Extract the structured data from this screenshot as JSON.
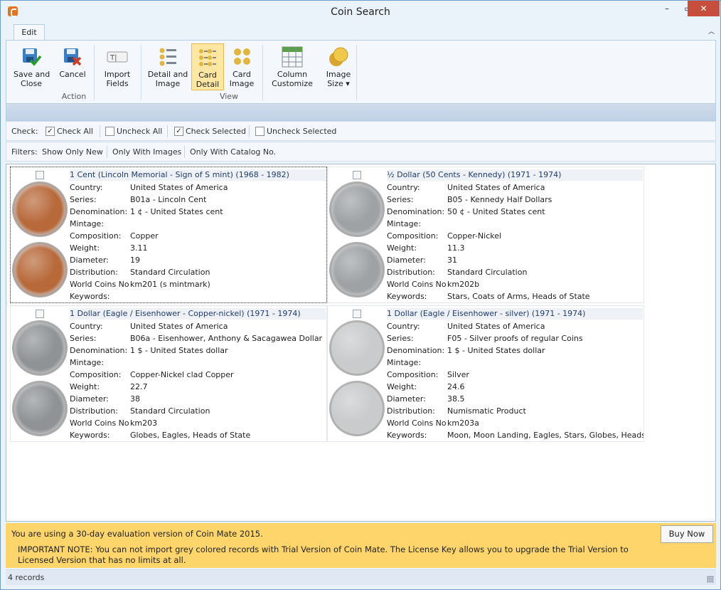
{
  "window": {
    "title": "Coin Search"
  },
  "ribbon": {
    "tab": "Edit",
    "groups": [
      {
        "label": "Action",
        "buttons": [
          {
            "label": "Save and\nClose",
            "icon": "save-check-icon"
          },
          {
            "label": "Cancel",
            "icon": "cancel-icon"
          },
          {
            "label": "Import\nFields",
            "icon": "import-fields-icon"
          }
        ]
      },
      {
        "label": "View",
        "buttons": [
          {
            "label": "Detail and\nImage",
            "icon": "detail-image-icon"
          },
          {
            "label": "Card\nDetail",
            "icon": "card-detail-icon",
            "active": true
          },
          {
            "label": "Card\nImage",
            "icon": "card-image-icon"
          },
          {
            "label": "Column\nCustomize",
            "icon": "column-customize-icon"
          },
          {
            "label": "Image\nSize ▾",
            "icon": "image-size-icon"
          }
        ]
      }
    ]
  },
  "check_bar": {
    "label": "Check:",
    "check_all": "Check All",
    "uncheck_all": "Uncheck All",
    "check_selected": "Check Selected",
    "uncheck_selected": "Uncheck Selected"
  },
  "filter_bar": {
    "label": "Filters:",
    "show_only_new": "Show Only New",
    "only_with_images": "Only With Images",
    "only_with_catalog": "Only With Catalog No."
  },
  "field_labels": {
    "country": "Country:",
    "series": "Series:",
    "denomination": "Denomination:",
    "mintage": "Mintage:",
    "composition": "Composition:",
    "weight": "Weight:",
    "diameter": "Diameter:",
    "distribution": "Distribution:",
    "world_coins_no": "World Coins No",
    "keywords": "Keywords:"
  },
  "cards": [
    {
      "title": "1 Cent (Lincoln Memorial - Sign of S mint)  (1968 - 1982)",
      "country": "United States of America",
      "series": "B01a - Lincoln Cent",
      "denomination": "1 ¢ - United States cent",
      "mintage": "",
      "composition": "Copper",
      "weight": "3.11",
      "diameter": "19",
      "distribution": "Standard Circulation",
      "world_coins_no": "km201 (s mintmark)",
      "keywords": "",
      "coin_color": "#b8693a"
    },
    {
      "title": "½ Dollar (50 Cents - Kennedy)  (1971 - 1974)",
      "country": "United States of America",
      "series": "B05 - Kennedy Half Dollars",
      "denomination": "50 ¢ - United States cent",
      "mintage": "",
      "composition": "Copper-Nickel",
      "weight": "11.3",
      "diameter": "31",
      "distribution": "Standard Circulation",
      "world_coins_no": "km202b",
      "keywords": "Stars, Coats of Arms, Heads of State",
      "coin_color": "#9ea2a5"
    },
    {
      "title": "1 Dollar (Eagle / Eisenhower - Copper-nickel)  (1971 - 1974)",
      "country": "United States of America",
      "series": "B06a - Eisenhower, Anthony & Sacagawea Dollar",
      "denomination": "1 $ - United States dollar",
      "mintage": "",
      "composition": "Copper-Nickel clad Copper",
      "weight": "22.7",
      "diameter": "38",
      "distribution": "Standard Circulation",
      "world_coins_no": "km203",
      "keywords": "Globes, Eagles, Heads of State",
      "coin_color": "#8f9396"
    },
    {
      "title": "1 Dollar (Eagle / Eisenhower - silver)  (1971 - 1974)",
      "country": "United States of America",
      "series": "F05 - Silver proofs of regular Coins",
      "denomination": "1 $ - United States dollar",
      "mintage": "",
      "composition": "Silver",
      "weight": "24.6",
      "diameter": "38.5",
      "distribution": "Numismatic Product",
      "world_coins_no": "km203a",
      "keywords": "Moon, Moon Landing, Eagles, Stars, Globes, Heads of State",
      "coin_color": "#c9cbcc"
    }
  ],
  "banner": {
    "line1": "You are using a 30-day evaluation version of Coin Mate 2015.",
    "line2": "IMPORTANT NOTE: You can not import grey colored records with Trial Version of Coin Mate. The License Key allows you to upgrade the Trial Version to Licensed Version that has no limits at all.",
    "buy_label": "Buy Now"
  },
  "status": {
    "records": "4 records"
  }
}
